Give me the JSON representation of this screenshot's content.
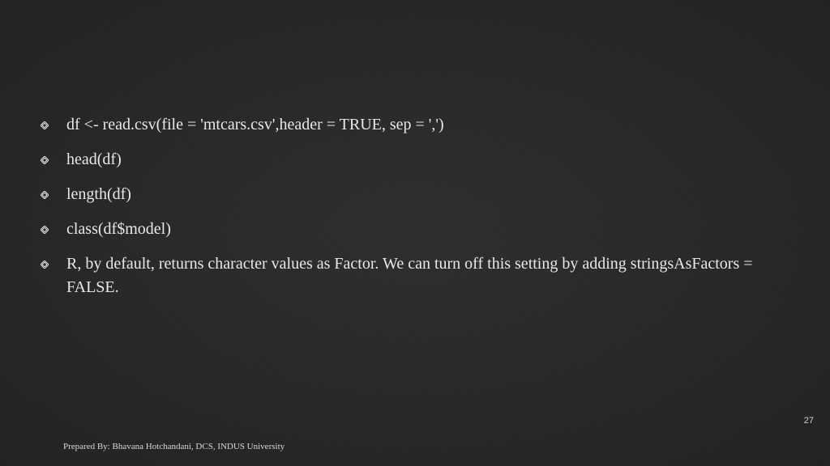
{
  "bullets": [
    "df <- read.csv(file = 'mtcars.csv',header =  TRUE, sep = ',')",
    "head(df)",
    "length(df)",
    "class(df$model)",
    "R, by default, returns character values as Factor. We can turn off this setting by adding stringsAsFactors = FALSE."
  ],
  "footer": "Prepared By: Bhavana Hotchandani, DCS, INDUS University",
  "page_number": "27"
}
